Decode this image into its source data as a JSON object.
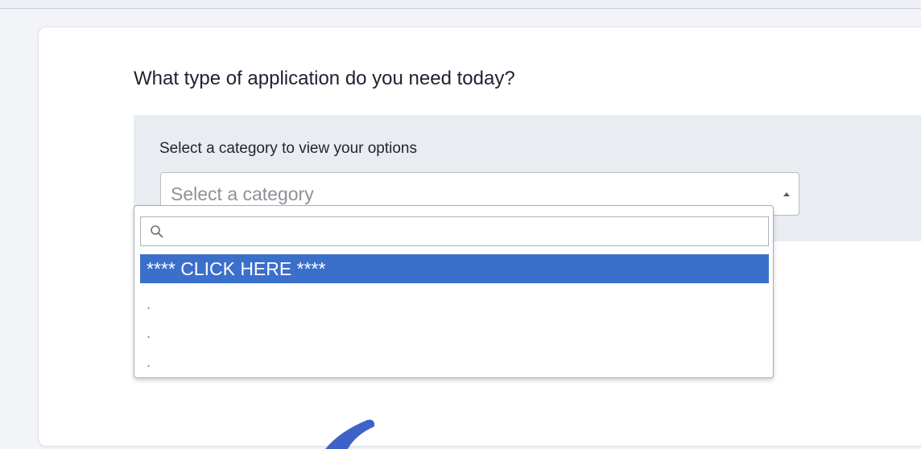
{
  "question": "What type of application do you need today?",
  "category_panel": {
    "label": "Select a category to view your options",
    "select_placeholder": "Select a category"
  },
  "dropdown": {
    "search_placeholder": "",
    "options": [
      {
        "label": "**** CLICK HERE ****",
        "highlighted": true
      },
      {
        "label": ".",
        "highlighted": false
      },
      {
        "label": ".",
        "highlighted": false
      },
      {
        "label": ".",
        "highlighted": false
      }
    ]
  },
  "colors": {
    "highlight": "#3b6fcc",
    "panel_bg": "#e9ecf1"
  },
  "icons": {
    "search": "search-icon",
    "select_arrow": "caret-up-icon"
  }
}
